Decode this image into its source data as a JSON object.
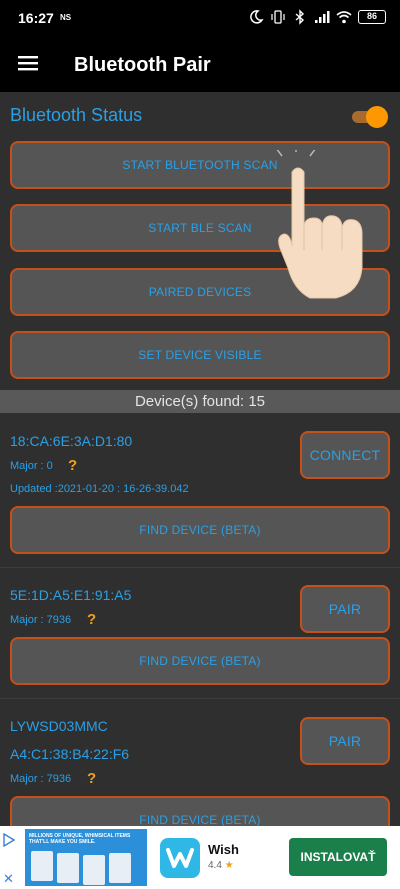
{
  "status_bar": {
    "time": "16:27",
    "carrier": "NS",
    "battery": "86"
  },
  "app_bar": {
    "title": "Bluetooth Pair"
  },
  "bluetooth_status": {
    "label": "Bluetooth Status",
    "enabled": true
  },
  "actions": {
    "start_scan": "START BLUETOOTH SCAN",
    "start_ble_scan": "START BLE SCAN",
    "paired_devices": "PAIRED DEVICES",
    "set_visible": "SET DEVICE VISIBLE"
  },
  "device_count": "Device(s) found: 15",
  "devices": [
    {
      "address": "18:CA:6E:3A:D1:80",
      "major": "Major : 0",
      "question": "?",
      "updated": "Updated :2021-01-20 : 16-26-39.042",
      "action": "CONNECT",
      "find": "FIND DEVICE (BETA)"
    },
    {
      "address": "5E:1D:A5:E1:91:A5",
      "major": "Major : 7936",
      "question": "?",
      "action": "PAIR",
      "find": "FIND DEVICE (BETA)"
    },
    {
      "name": "LYWSD03MMC",
      "address": "A4:C1:38:B4:22:F6",
      "major": "Major : 7936",
      "question": "?",
      "action": "PAIR",
      "find": "FIND DEVICE (BETA)"
    }
  ],
  "ad": {
    "banner_text": "MILLIONS OF UNIQUE, WHIMSICAL ITEMS THAT'LL MAKE YOU SMILE.",
    "app_name": "Wish",
    "rating": "4.4",
    "star": "★",
    "install": "INSTALOVAŤ",
    "close": "✕"
  },
  "colors": {
    "accent_text": "#2aa0e6",
    "button_border": "#c4501a",
    "toggle_thumb": "#ff9800",
    "install_button": "#1a7f4a"
  },
  "icons": [
    "menu-icon",
    "moon-icon",
    "vibrate-icon",
    "bluetooth-icon",
    "signal-icon",
    "wifi-icon",
    "battery-icon",
    "hand-pointer-icon",
    "ad-choices-icon",
    "close-icon"
  ]
}
